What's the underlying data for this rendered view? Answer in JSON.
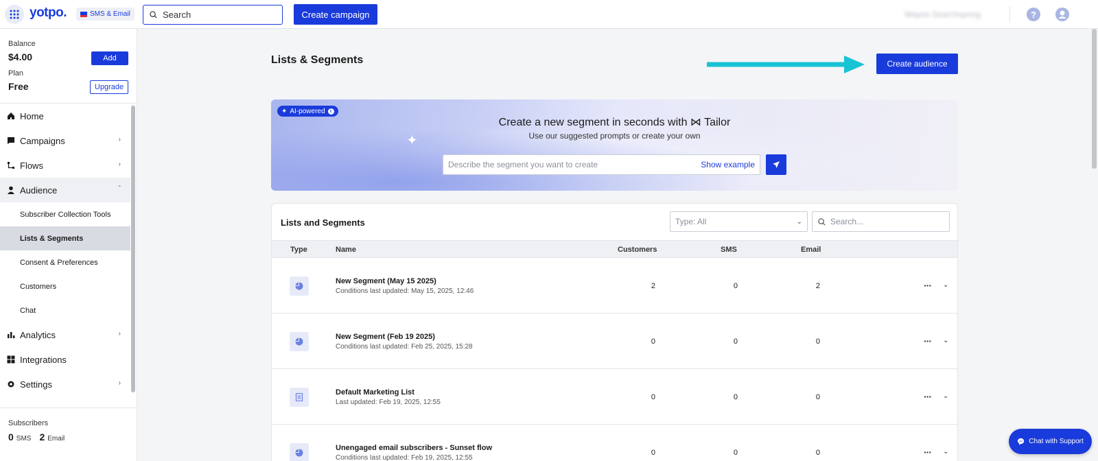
{
  "topbar": {
    "logo": "yotpo.",
    "product": "SMS & Email",
    "search_placeholder": "Search",
    "create_campaign": "Create campaign",
    "user_name": "Wayne Searchspring"
  },
  "sidebar": {
    "balance_label": "Balance",
    "balance_value": "$4.00",
    "add_label": "Add",
    "plan_label": "Plan",
    "plan_value": "Free",
    "upgrade_label": "Upgrade",
    "nav": {
      "home": "Home",
      "campaigns": "Campaigns",
      "flows": "Flows",
      "audience": "Audience",
      "subscriber_collection_tools": "Subscriber Collection Tools",
      "lists_segments": "Lists & Segments",
      "consent_preferences": "Consent & Preferences",
      "customers": "Customers",
      "chat": "Chat",
      "analytics": "Analytics",
      "integrations": "Integrations",
      "settings": "Settings"
    },
    "subscribers_label": "Subscribers",
    "sms_count": "0",
    "sms_unit": "SMS",
    "email_count": "2",
    "email_unit": "Email"
  },
  "main": {
    "title": "Lists & Segments",
    "create_audience": "Create audience",
    "banner": {
      "badge": "AI-powered",
      "title": "Create a new segment in seconds with ⋈ Tailor",
      "subtitle": "Use our suggested prompts or create your own",
      "input_placeholder": "Describe the segment you want to create",
      "show_example": "Show example"
    },
    "table": {
      "title": "Lists and Segments",
      "type_filter": "Type: All",
      "search_placeholder": "Search...",
      "headers": {
        "type": "Type",
        "name": "Name",
        "customers": "Customers",
        "sms": "SMS",
        "email": "Email"
      },
      "rows": [
        {
          "kind": "segment",
          "name": "New Segment (May 15 2025)",
          "updated": "Conditions last updated: May 15, 2025, 12:46",
          "customers": "2",
          "sms": "0",
          "email": "2"
        },
        {
          "kind": "segment",
          "name": "New Segment (Feb 19 2025)",
          "updated": "Conditions last updated: Feb 25, 2025, 15:28",
          "customers": "0",
          "sms": "0",
          "email": "0"
        },
        {
          "kind": "list",
          "name": "Default Marketing List",
          "updated": "Last updated: Feb 19, 2025, 12:55",
          "customers": "0",
          "sms": "0",
          "email": "0"
        },
        {
          "kind": "segment",
          "name": "Unengaged email subscribers - Sunset flow",
          "updated": "Conditions last updated: Feb 19, 2025, 12:55",
          "customers": "0",
          "sms": "0",
          "email": "0"
        }
      ]
    }
  },
  "chat_support": "Chat with Support",
  "colors": {
    "accent": "#1a3bdb",
    "arrow": "#19c3d6"
  }
}
